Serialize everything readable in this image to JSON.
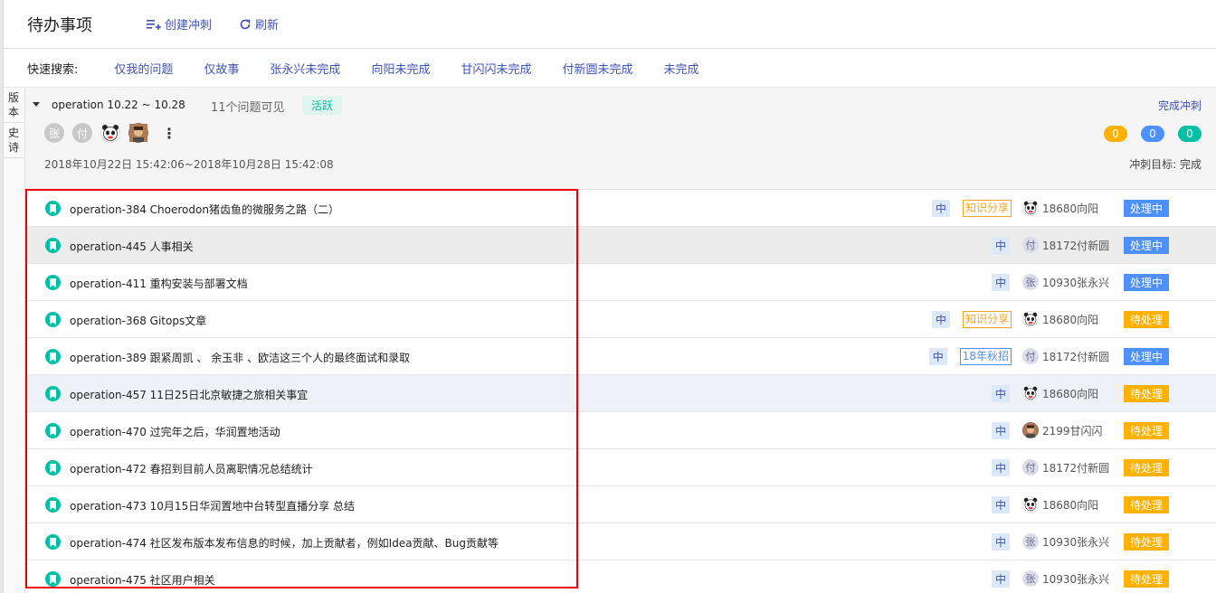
{
  "header": {
    "title": "待办事项",
    "create_sprint": "创建冲刺",
    "refresh": "刷新"
  },
  "quick_search": {
    "label": "快速搜索:",
    "items": [
      "仅我的问题",
      "仅故事",
      "张永兴未完成",
      "向阳未完成",
      "甘闪闪未完成",
      "付新圆未完成",
      "未完成"
    ]
  },
  "side_tabs": [
    "版本",
    "史诗"
  ],
  "sprint": {
    "name": "operation 10.22 ~ 10.28",
    "issue_count": "11个问题可见",
    "status": "活跃",
    "complete_action": "完成冲刺",
    "avatars": [
      "张",
      "付"
    ],
    "counts": [
      {
        "value": "0",
        "color": "#ffb100"
      },
      {
        "value": "0",
        "color": "#4d90fe"
      },
      {
        "value": "0",
        "color": "#00bfa5"
      }
    ],
    "time_range": "2018年10月22日 15:42:06~2018年10月28日 15:42:08",
    "goal": "冲刺目标: 完成"
  },
  "issues": [
    {
      "title": "operation-384 Choerodon猪齿鱼的微服务之路（二）",
      "priority": "中",
      "label": "知识分享",
      "label_color": "#f5a623",
      "assignee_avatar": "panda",
      "assignee_text": "",
      "assignee": "18680向阳",
      "status": "处理中",
      "status_color": "#4d90fe"
    },
    {
      "title": "operation-445 人事相关",
      "priority": "中",
      "label": "",
      "label_color": "",
      "assignee_avatar": "text",
      "assignee_text": "付",
      "assignee": "18172付新圆",
      "status": "处理中",
      "status_color": "#4d90fe"
    },
    {
      "title": "operation-411 重构安装与部署文档",
      "priority": "中",
      "label": "",
      "label_color": "",
      "assignee_avatar": "text",
      "assignee_text": "张",
      "assignee": "10930张永兴",
      "status": "处理中",
      "status_color": "#4d90fe"
    },
    {
      "title": "operation-368 Gitops文章",
      "priority": "中",
      "label": "知识分享",
      "label_color": "#f5a623",
      "assignee_avatar": "panda",
      "assignee_text": "",
      "assignee": "18680向阳",
      "status": "待处理",
      "status_color": "#ffb100"
    },
    {
      "title": "operation-389 跟紧周凯 、 余玉非 、欧洁这三个人的最终面试和录取",
      "priority": "中",
      "label": "18年秋招",
      "label_color": "#4d90fe",
      "assignee_avatar": "text",
      "assignee_text": "付",
      "assignee": "18172付新圆",
      "status": "处理中",
      "status_color": "#4d90fe"
    },
    {
      "title": "operation-457 11日25日北京敏捷之旅相关事宜",
      "priority": "中",
      "label": "",
      "label_color": "",
      "assignee_avatar": "panda",
      "assignee_text": "",
      "assignee": "18680向阳",
      "status": "待处理",
      "status_color": "#ffb100"
    },
    {
      "title": "operation-470 过完年之后，华润置地活动",
      "priority": "中",
      "label": "",
      "label_color": "",
      "assignee_avatar": "photo",
      "assignee_text": "",
      "assignee": "2199甘闪闪",
      "status": "待处理",
      "status_color": "#ffb100"
    },
    {
      "title": "operation-472 春招到目前人员离职情况总结统计",
      "priority": "中",
      "label": "",
      "label_color": "",
      "assignee_avatar": "text",
      "assignee_text": "付",
      "assignee": "18172付新圆",
      "status": "待处理",
      "status_color": "#ffb100"
    },
    {
      "title": "operation-473 10月15日华润置地中台转型直播分享 总结",
      "priority": "中",
      "label": "",
      "label_color": "",
      "assignee_avatar": "panda",
      "assignee_text": "",
      "assignee": "18680向阳",
      "status": "待处理",
      "status_color": "#ffb100"
    },
    {
      "title": "operation-474 社区发布版本发布信息的时候，加上贡献者，例如Idea贡献、Bug贡献等",
      "priority": "中",
      "label": "",
      "label_color": "",
      "assignee_avatar": "text",
      "assignee_text": "张",
      "assignee": "10930张永兴",
      "status": "待处理",
      "status_color": "#ffb100"
    },
    {
      "title": "operation-475 社区用户相关",
      "priority": "中",
      "label": "",
      "label_color": "",
      "assignee_avatar": "text",
      "assignee_text": "张",
      "assignee": "10930张永兴",
      "status": "待处理",
      "status_color": "#ffb100"
    }
  ]
}
